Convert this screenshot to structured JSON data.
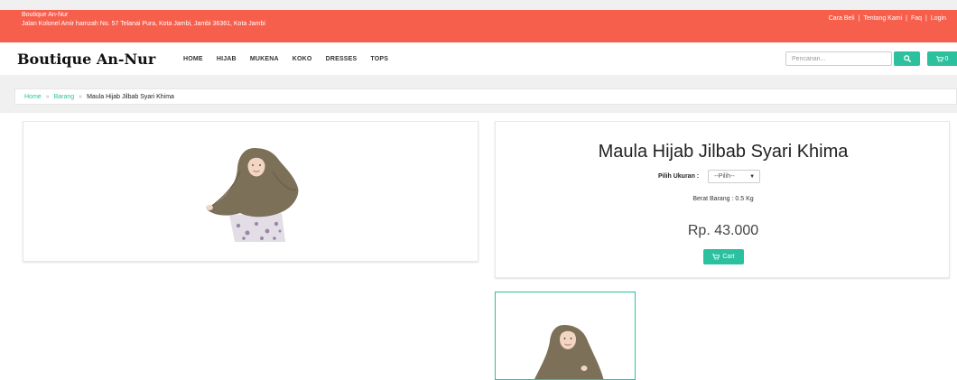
{
  "topbar": {
    "store_name": "Boutique An-Nur",
    "address": "Jalan Kolonel Amir hamzah No. 57 Telanai Pura, Kota Jambi, Jambi 36361, Kota Jambi",
    "links": [
      "Cara Beli",
      "Tentang Kami",
      "Faq",
      "Login"
    ],
    "separator": "|",
    "bg_color": "#f75f4d"
  },
  "navbar": {
    "brand": "Boutique An-Nur",
    "menu": [
      "HOME",
      "HIJAB",
      "MUKENA",
      "KOKO",
      "DRESSES",
      "TOPS"
    ],
    "search_placeholder": "Pencarian...",
    "search_icon": "search-icon",
    "cart_icon": "cart-icon",
    "cart_count": "0",
    "accent_color": "#2cc19e"
  },
  "breadcrumb": {
    "items": [
      "Home",
      "Barang"
    ],
    "current": "Maula Hijab Jilbab Syari Khima",
    "separator": "»"
  },
  "product": {
    "title": "Maula Hijab Jilbab Syari Khima",
    "size_label": "Pilih Ukuran :",
    "size_selected": "--Pilih--",
    "weight": "Berat Barang : 0.5 Kg",
    "price": "Rp. 43.000",
    "cart_label": "Cart",
    "hijab_color": "#7d7059"
  }
}
